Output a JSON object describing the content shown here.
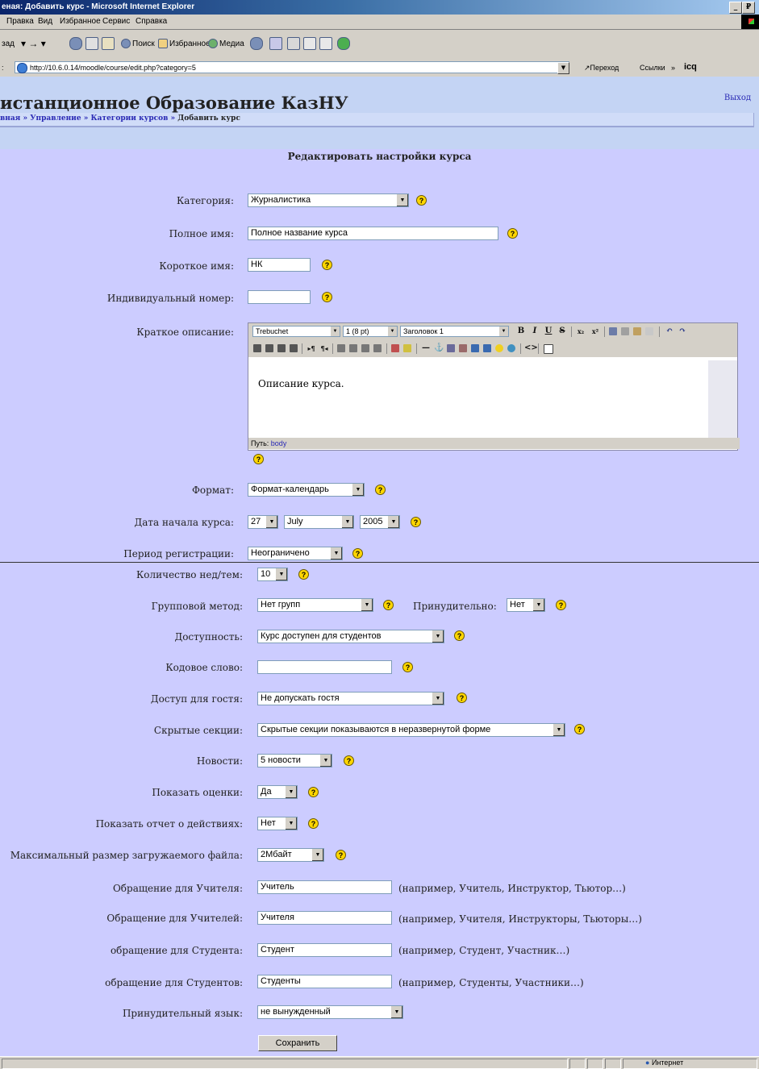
{
  "window": {
    "title": "еная: Добавить курс - Microsoft Internet Explorer",
    "controls": [
      "_",
      "₽"
    ]
  },
  "menu": [
    "Правка",
    "Вид",
    "Избранное",
    "Сервис",
    "Справка"
  ],
  "toolbar": {
    "back_label": "зад",
    "search_label": "Поиск",
    "favorites_label": "Избранное",
    "media_label": "Медиа"
  },
  "address": {
    "url": "http://10.6.0.14/moodle/course/edit.php?category=5",
    "go_label": "Переход",
    "links_label": "Ссылки",
    "icq_label": "icq"
  },
  "header": {
    "site_title": "истанционное Образование КазНУ",
    "logout_label": "Выход",
    "breadcrumb": {
      "items": [
        "вная",
        "Управление",
        "Категории курсов"
      ],
      "separator": "»",
      "current": "Добавить курс"
    }
  },
  "page_heading": "Редактировать настройки курса",
  "help_glyph": "?",
  "form": {
    "category": {
      "label": "Категория:",
      "value": "Журналистика"
    },
    "fullname": {
      "label": "Полное имя:",
      "value": "Полное название курса"
    },
    "shortname": {
      "label": "Короткое имя:",
      "value": "НК"
    },
    "idnumber": {
      "label": "Индивидуальный номер:",
      "value": ""
    },
    "summary": {
      "label": "Краткое описание:",
      "font": "Trebuchet",
      "size": "1 (8 pt)",
      "style": "Заголовок 1",
      "body_text": "Описание курса.",
      "path_label": "Путь:",
      "path_value": "body"
    },
    "format": {
      "label": "Формат:",
      "value": "Формат-календарь"
    },
    "startdate": {
      "label": "Дата начала курса:",
      "day": "27",
      "month": "July",
      "year": "2005"
    },
    "enrolperiod": {
      "label": "Период регистрации:",
      "value": "Неограничено"
    },
    "numsections": {
      "label": "Количество нед/тем:",
      "value": "10"
    },
    "groupmode": {
      "label": "Групповой метод:",
      "value": "Нет групп",
      "force_label": "Принудительно:",
      "force_value": "Нет"
    },
    "visible": {
      "label": "Доступность:",
      "value": "Курс доступен для студентов"
    },
    "password": {
      "label": "Кодовое слово:",
      "value": ""
    },
    "guest": {
      "label": "Доступ для гостя:",
      "value": "Не допускать гостя"
    },
    "hiddensections": {
      "label": "Скрытые секции:",
      "value": "Скрытые секции показываются в неразвернутой форме"
    },
    "newsitems": {
      "label": "Новости:",
      "value": "5 новости"
    },
    "showgrades": {
      "label": "Показать оценки:",
      "value": "Да"
    },
    "showreports": {
      "label": "Показать отчет о действиях:",
      "value": "Нет"
    },
    "maxbytes": {
      "label": "Максимальный размер загружаемого файла:",
      "value": "2Мбайт"
    },
    "teacher": {
      "label": "Обращение для Учителя:",
      "value": "Учитель",
      "hint": "(например, Учитель, Инструктор, Тьютор…)"
    },
    "teachers": {
      "label": "Обращение для Учителей:",
      "value": "Учителя",
      "hint": "(например, Учителя, Инструкторы, Тьюторы…)"
    },
    "student": {
      "label": "обращение для Студента:",
      "value": "Студент",
      "hint": "(например, Студент, Участник…)"
    },
    "students": {
      "label": "обращение для Студентов:",
      "value": "Студенты",
      "hint": "(например, Студенты, Участники…)"
    },
    "lang": {
      "label": "Принудительный язык:",
      "value": "не вынужденный"
    },
    "submit_label": "Сохранить"
  },
  "status": {
    "zone": "Интернет"
  }
}
